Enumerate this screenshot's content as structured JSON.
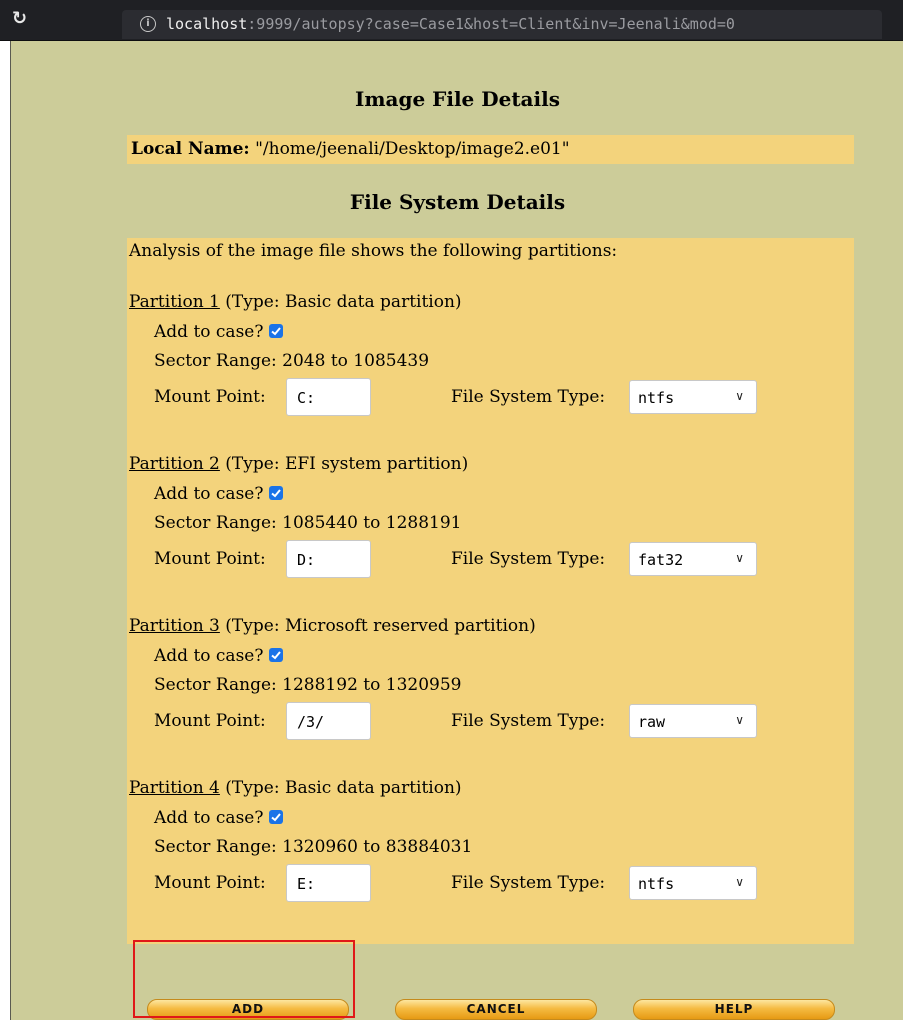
{
  "browser": {
    "url_host": "localhost",
    "url_rest": ":9999/autopsy?case=Case1&host=Client&inv=Jeenali&mod=0"
  },
  "page": {
    "image_heading": "Image File Details",
    "local_name_label": "Local Name:",
    "local_name_value": "\"/home/jeenali/Desktop/image2.e01\"",
    "fs_heading": "File System Details",
    "analysis_text": "Analysis of the image file shows the following partitions:"
  },
  "partitions": [
    {
      "title": "Partition 1",
      "type": "(Type: Basic data partition)",
      "add_label": "Add to case?",
      "checked": true,
      "sector_range": "Sector Range: 2048 to 1085439",
      "mount_label": "Mount Point:",
      "mount_value": "C:",
      "fs_label": "File System Type:",
      "fs_value": "ntfs"
    },
    {
      "title": "Partition 2",
      "type": "(Type: EFI system partition)",
      "add_label": "Add to case?",
      "checked": true,
      "sector_range": "Sector Range: 1085440 to 1288191",
      "mount_label": "Mount Point:",
      "mount_value": "D:",
      "fs_label": "File System Type:",
      "fs_value": "fat32"
    },
    {
      "title": "Partition 3",
      "type": "(Type: Microsoft reserved partition)",
      "add_label": "Add to case?",
      "checked": true,
      "sector_range": "Sector Range: 1288192 to 1320959",
      "mount_label": "Mount Point:",
      "mount_value": "/3/",
      "fs_label": "File System Type:",
      "fs_value": "raw"
    },
    {
      "title": "Partition 4",
      "type": "(Type: Basic data partition)",
      "add_label": "Add to case?",
      "checked": true,
      "sector_range": "Sector Range: 1320960 to 83884031",
      "mount_label": "Mount Point:",
      "mount_value": "E:",
      "fs_label": "File System Type:",
      "fs_value": "ntfs"
    }
  ],
  "buttons": {
    "add": "ADD",
    "cancel": "CANCEL",
    "help": "HELP"
  },
  "colors": {
    "page_bg": "#cccc99",
    "panel_bg": "#f3d37c",
    "checkbox": "#1a73e8",
    "highlight": "#e01818"
  }
}
